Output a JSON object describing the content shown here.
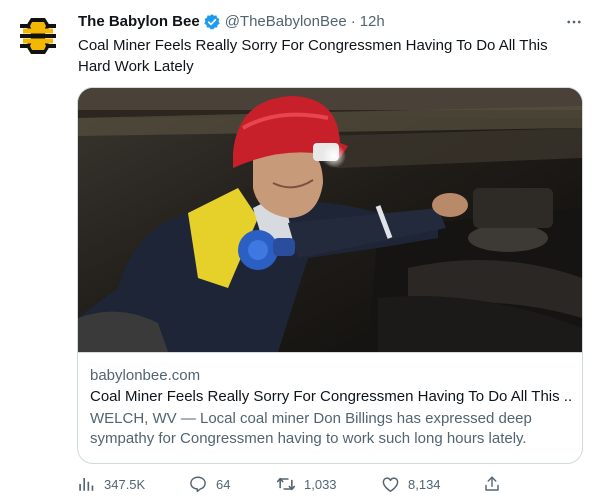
{
  "tweet": {
    "author": {
      "display_name": "The Babylon Bee",
      "handle": "@TheBabylonBee",
      "verified": true,
      "avatar_icon": "bee-logo-icon"
    },
    "separator": "·",
    "timestamp": "12h",
    "text": "Coal Miner Feels Really Sorry For Congressmen Having To Do All This Hard Work Lately",
    "card": {
      "image_icon": "coal-miner-photo",
      "domain": "babylonbee.com",
      "title": "Coal Miner Feels Really Sorry For Congressmen Having To Do All This ...",
      "description": "WELCH, WV — Local coal miner Don Billings has expressed deep sympathy for Congressmen having to work such long hours lately."
    },
    "actions": {
      "views": "347.5K",
      "replies": "64",
      "retweets": "1,033",
      "likes": "8,134"
    }
  },
  "colors": {
    "text_primary": "#0f1419",
    "text_secondary": "#536471",
    "verified_blue": "#1d9bf0",
    "border": "#cfd9de"
  }
}
